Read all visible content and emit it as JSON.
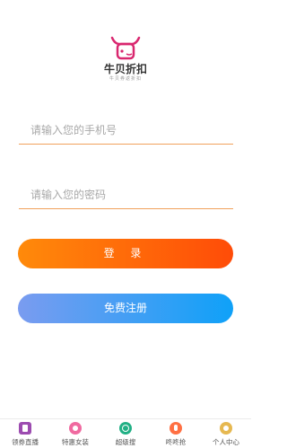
{
  "logo": {
    "name": "牛贝折扣",
    "slogan": "牛贝券返折扣"
  },
  "form": {
    "phone_placeholder": "请输入您的手机号",
    "password_placeholder": "请输入您的密码"
  },
  "buttons": {
    "login": "登 录",
    "register": "免费注册"
  },
  "tabbar": {
    "items": [
      {
        "label": "领券直播",
        "icon": "live-icon"
      },
      {
        "label": "特惠女装",
        "icon": "dress-icon"
      },
      {
        "label": "超级搜",
        "icon": "search-icon"
      },
      {
        "label": "咚咚抢",
        "icon": "flash-sale-icon"
      },
      {
        "label": "个人中心",
        "icon": "profile-icon"
      }
    ]
  },
  "colors": {
    "login_start": "#ff8a0a",
    "login_end": "#ff4c08",
    "register_start": "#7a9cf0",
    "register_end": "#0fa1f8",
    "field_underline": "#f0a15c",
    "logo_brand": "#d9276f"
  }
}
